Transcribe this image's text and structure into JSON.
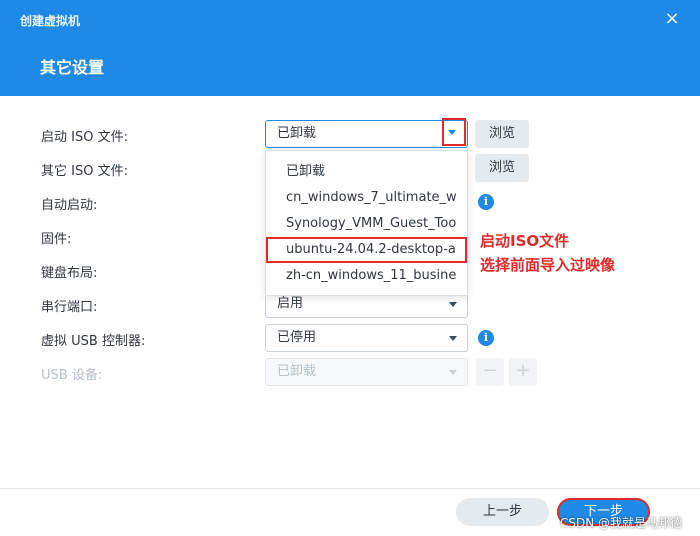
{
  "window": {
    "title": "创建虚拟机",
    "close_glyph": "×"
  },
  "page": {
    "title": "其它设置"
  },
  "form": {
    "boot_iso": {
      "label": "启动 ISO 文件:",
      "value": "已卸载",
      "browse": "浏览"
    },
    "other_iso": {
      "label": "其它 ISO 文件:",
      "browse": "浏览"
    },
    "autostart": {
      "label": "自动启动:"
    },
    "firmware": {
      "label": "固件:"
    },
    "keyboard": {
      "label": "键盘布局:"
    },
    "serial": {
      "label": "串行端口:",
      "value": "启用"
    },
    "usb_controller": {
      "label": "虚拟 USB 控制器:",
      "value": "已停用"
    },
    "usb_device": {
      "label": "USB 设备:",
      "value": "已卸载",
      "minus": "−",
      "plus": "+"
    }
  },
  "dropdown": {
    "items": [
      "已卸载",
      "cn_windows_7_ultimate_w",
      "Synology_VMM_Guest_Too",
      "ubuntu-24.04.2-desktop-a",
      "zh-cn_windows_11_busine"
    ],
    "selected_index": 3
  },
  "annotation": {
    "line1": "启动ISO文件",
    "line2": "选择前面导入过映像"
  },
  "info_glyph": "i",
  "footer": {
    "prev": "上一步",
    "next": "下一步"
  },
  "watermark": "CSDN @我就是马邦德",
  "colors": {
    "accent": "#1f8ae6",
    "highlight": "#e02b2b"
  }
}
